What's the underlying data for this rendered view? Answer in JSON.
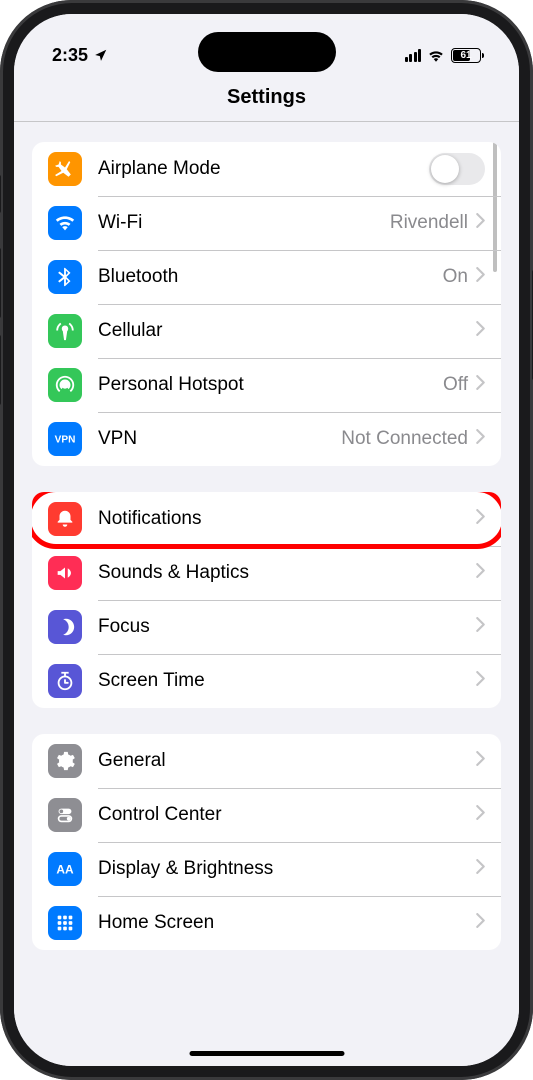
{
  "status": {
    "time": "2:35",
    "battery": "61"
  },
  "header": {
    "title": "Settings"
  },
  "sections": [
    {
      "rows": [
        {
          "icon": "airplane",
          "bg": "bg-orange",
          "label": "Airplane Mode",
          "value": "",
          "toggle": true
        },
        {
          "icon": "wifi",
          "bg": "bg-blue",
          "label": "Wi-Fi",
          "value": "Rivendell"
        },
        {
          "icon": "bluetooth",
          "bg": "bg-blue",
          "label": "Bluetooth",
          "value": "On"
        },
        {
          "icon": "cellular",
          "bg": "bg-green",
          "label": "Cellular",
          "value": ""
        },
        {
          "icon": "hotspot",
          "bg": "bg-green",
          "label": "Personal Hotspot",
          "value": "Off"
        },
        {
          "icon": "vpn",
          "bg": "bg-vpn",
          "label": "VPN",
          "value": "Not Connected"
        }
      ]
    },
    {
      "rows": [
        {
          "icon": "notifications",
          "bg": "bg-red",
          "label": "Notifications",
          "value": "",
          "highlight": true
        },
        {
          "icon": "sounds",
          "bg": "bg-pink",
          "label": "Sounds & Haptics",
          "value": ""
        },
        {
          "icon": "focus",
          "bg": "bg-indigo",
          "label": "Focus",
          "value": ""
        },
        {
          "icon": "screentime",
          "bg": "bg-indigo",
          "label": "Screen Time",
          "value": ""
        }
      ]
    },
    {
      "rows": [
        {
          "icon": "general",
          "bg": "bg-gray",
          "label": "General",
          "value": ""
        },
        {
          "icon": "controlcenter",
          "bg": "bg-gray",
          "label": "Control Center",
          "value": ""
        },
        {
          "icon": "display",
          "bg": "bg-blue",
          "label": "Display & Brightness",
          "value": ""
        },
        {
          "icon": "homescreen",
          "bg": "bg-blue",
          "label": "Home Screen",
          "value": ""
        }
      ]
    }
  ]
}
